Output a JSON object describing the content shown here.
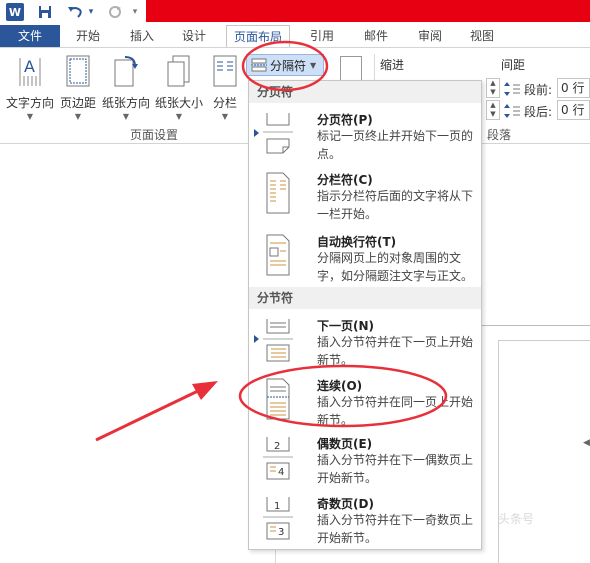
{
  "quick_access": {
    "word_icon": "W",
    "save_icon": "save-icon",
    "undo_icon": "undo-icon",
    "redo_icon": "redo-icon",
    "customize_icon": "▾"
  },
  "tabs": [
    {
      "label": "文件",
      "id": "file"
    },
    {
      "label": "开始",
      "id": "home"
    },
    {
      "label": "插入",
      "id": "insert"
    },
    {
      "label": "设计",
      "id": "design"
    },
    {
      "label": "页面布局",
      "id": "layout"
    },
    {
      "label": "引用",
      "id": "references"
    },
    {
      "label": "邮件",
      "id": "mailings"
    },
    {
      "label": "审阅",
      "id": "review"
    },
    {
      "label": "视图",
      "id": "view"
    }
  ],
  "ribbon": {
    "text_direction": "文字方向",
    "margins": "页边距",
    "orientation": "纸张方向",
    "size": "纸张大小",
    "columns": "分栏",
    "breaks": "分隔符",
    "page_setup_group": "页面设置",
    "indent_label": "缩进",
    "spacing_label": "间距",
    "before_label": "段前:",
    "after_label": "段后:",
    "before_value": "0 行",
    "after_value": "0 行",
    "paragraph_group": "段落"
  },
  "dropdown": {
    "page_breaks_header": "分页符",
    "section_breaks_header": "分节符",
    "items": [
      {
        "title": "分页符(P)",
        "desc": "标记一页终止并开始下一页的点。"
      },
      {
        "title": "分栏符(C)",
        "desc": "指示分栏符后面的文字将从下一栏开始。"
      },
      {
        "title": "自动换行符(T)",
        "desc": "分隔网页上的对象周围的文字，如分隔题注文字与正文。"
      },
      {
        "title": "下一页(N)",
        "desc": "插入分节符并在下一页上开始新节。"
      },
      {
        "title": "连续(O)",
        "desc": "插入分节符并在同一页上开始新节。"
      },
      {
        "title": "偶数页(E)",
        "desc": "插入分节符并在下一偶数页上开始新节。"
      },
      {
        "title": "奇数页(D)",
        "desc": "插入分节符并在下一奇数页上开始新节。"
      }
    ]
  },
  "watermark": "头条号",
  "colors": {
    "accent": "#2b579a",
    "annotation": "#e8303a",
    "title_bar": "#e60012"
  }
}
